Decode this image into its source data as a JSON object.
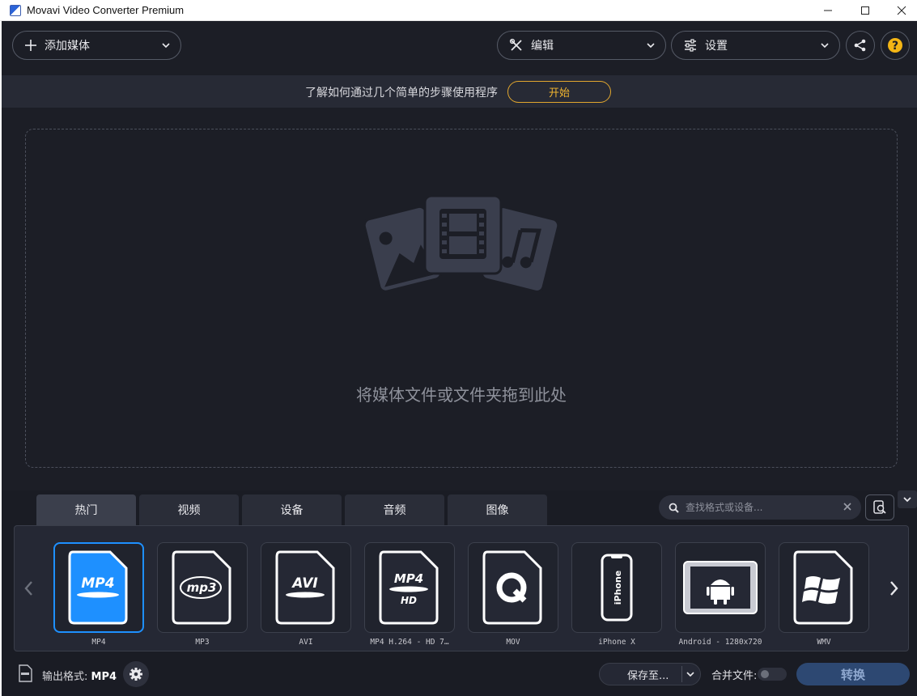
{
  "window": {
    "title": "Movavi Video Converter Premium"
  },
  "toolbar": {
    "add_media_label": "添加媒体",
    "edit_label": "编辑",
    "settings_label": "设置"
  },
  "banner": {
    "text": "了解如何通过几个简单的步骤使用程序",
    "start_label": "开始"
  },
  "dropzone": {
    "text": "将媒体文件或文件夹拖到此处"
  },
  "tabs": [
    {
      "label": "热门",
      "active": true
    },
    {
      "label": "视频",
      "active": false
    },
    {
      "label": "设备",
      "active": false
    },
    {
      "label": "音频",
      "active": false
    },
    {
      "label": "图像",
      "active": false
    }
  ],
  "search": {
    "placeholder": "查找格式或设备..."
  },
  "presets": [
    {
      "label": "MP4",
      "icon": "mp4-icon",
      "selected": true
    },
    {
      "label": "MP3",
      "icon": "mp3-icon",
      "selected": false
    },
    {
      "label": "AVI",
      "icon": "avi-icon",
      "selected": false
    },
    {
      "label": "MP4 H.264 - HD 7…",
      "icon": "mp4-hd-icon",
      "selected": false
    },
    {
      "label": "MOV",
      "icon": "quicktime-icon",
      "selected": false
    },
    {
      "label": "iPhone X",
      "icon": "iphone-icon",
      "selected": false
    },
    {
      "label": "Android - 1280x720",
      "icon": "android-tablet-icon",
      "selected": false
    },
    {
      "label": "WMV",
      "icon": "windows-icon",
      "selected": false
    }
  ],
  "bottom": {
    "output_format_label": "输出格式:",
    "output_format_value": "MP4",
    "save_to_label": "保存至...",
    "merge_label": "合并文件:",
    "convert_label": "转换"
  },
  "colors": {
    "background": "#1c1e26",
    "accent_blue": "#1e90ff",
    "accent_orange": "#e2a72e",
    "convert_button": "#2d4872"
  }
}
